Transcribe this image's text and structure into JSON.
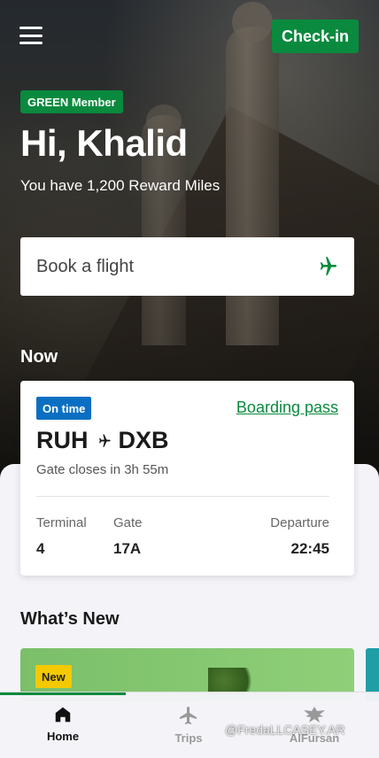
{
  "header": {
    "menu_icon": "hamburger-menu-icon",
    "checkin_label": "Check-in"
  },
  "profile": {
    "member_badge": "GREEN Member",
    "greeting": "Hi, Khalid",
    "miles_text": "You have 1,200 Reward Miles"
  },
  "booking": {
    "placeholder": "Book a flight",
    "icon": "airplane-icon"
  },
  "now": {
    "title": "Now",
    "status": "On time",
    "boarding_pass_label": "Boarding pass",
    "origin": "RUH",
    "destination": "DXB",
    "route_icon": "airplane-icon",
    "gate_closes": "Gate closes in 3h 55m",
    "terminal_label": "Terminal",
    "terminal_value": "4",
    "gate_label": "Gate",
    "gate_value": "17A",
    "departure_label": "Departure",
    "departure_value": "22:45"
  },
  "whats_new": {
    "title": "What’s New",
    "badge": "New"
  },
  "bottom_nav": {
    "items": [
      {
        "label": "Home",
        "icon": "home-icon",
        "active": true
      },
      {
        "label": "Trips",
        "icon": "airplane-icon",
        "active": false
      },
      {
        "label": "AlFursan",
        "icon": "alfursan-falcon-icon",
        "active": false
      }
    ]
  },
  "colors": {
    "brand_green": "#0a8a3e",
    "status_blue": "#0a6fc2",
    "new_yellow": "#f5c900",
    "sheet_bg": "#f4f4f8"
  },
  "overlay": {
    "watermark": "@FredaLLCASEY.AR"
  }
}
